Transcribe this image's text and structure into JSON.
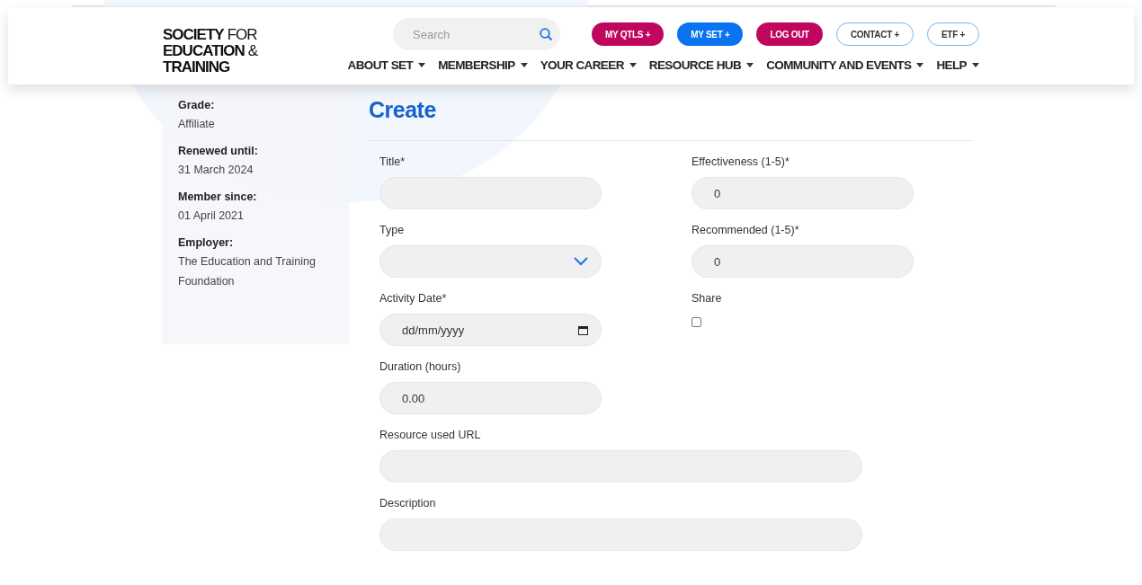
{
  "logo": {
    "lines": [
      "SOCIETY",
      "FOR",
      "EDUCATION",
      "&",
      "TRAINING"
    ]
  },
  "search": {
    "placeholder": "Search"
  },
  "top_buttons": [
    {
      "label": "MY QTLS +",
      "kind": "magenta"
    },
    {
      "label": "MY SET +",
      "kind": "blue"
    },
    {
      "label": "LOG OUT",
      "kind": "magenta"
    },
    {
      "label": "CONTACT +",
      "kind": "outline"
    },
    {
      "label": "ETF +",
      "kind": "outline"
    }
  ],
  "nav": [
    "ABOUT SET",
    "MEMBERSHIP",
    "YOUR CAREER",
    "RESOURCE HUB",
    "COMMUNITY AND EVENTS",
    "HELP"
  ],
  "sidebar": [
    {
      "label": "Grade:",
      "value": "Affiliate"
    },
    {
      "label": "Renewed until:",
      "value": "31 March 2024"
    },
    {
      "label": "Member since:",
      "value": "01 April 2021"
    },
    {
      "label": "Employer:",
      "value": "The Education and Training Foundation"
    }
  ],
  "form": {
    "title": "Create",
    "left": [
      {
        "label": "Title*",
        "kind": "text"
      },
      {
        "label": "Type",
        "kind": "select"
      },
      {
        "label": "Activity Date*",
        "kind": "date",
        "placeholder": "dd/mm/yyyy"
      },
      {
        "label": "Duration (hours)",
        "kind": "text",
        "value": "0.00"
      }
    ],
    "right": [
      {
        "label": "Effectiveness (1-5)*",
        "kind": "text",
        "value": "0"
      },
      {
        "label": "Recommended (1-5)*",
        "kind": "text",
        "value": "0"
      },
      {
        "label": "Share",
        "kind": "checkbox",
        "checked": false
      }
    ],
    "wide": [
      {
        "label": "Resource used URL",
        "kind": "text"
      },
      {
        "label": "Description",
        "kind": "text"
      }
    ]
  }
}
